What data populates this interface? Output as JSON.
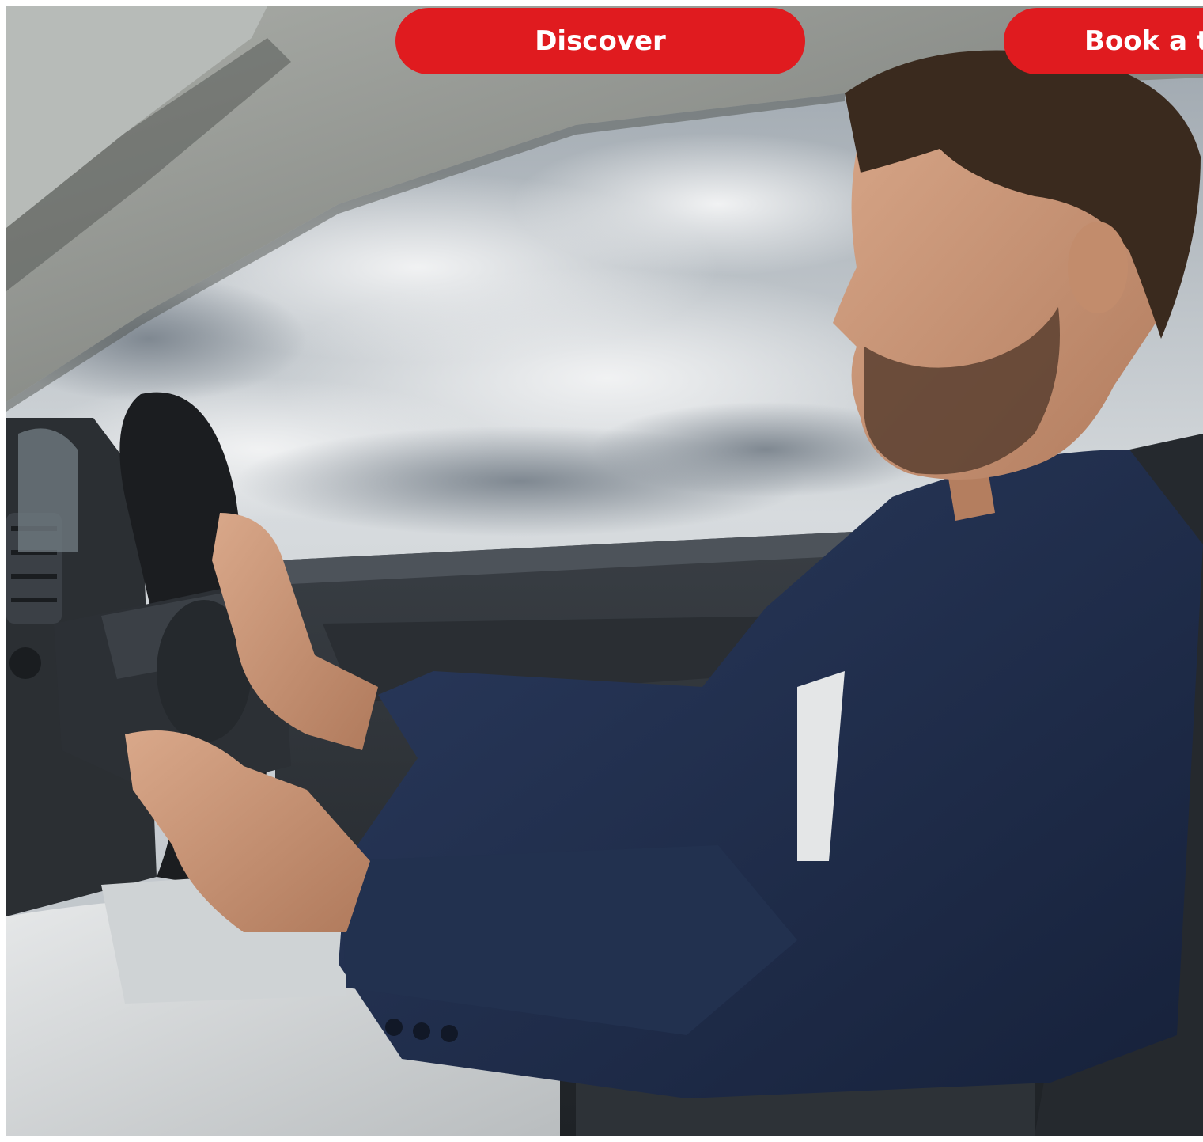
{
  "hero": {
    "image_description": "",
    "buttons": {
      "discover_label": "Discover",
      "book_label": "Book a t"
    }
  },
  "colors": {
    "cta_background": "#e01b1f",
    "cta_text": "#ffffff",
    "sky": "#c9ced3",
    "headliner": "#8f928e",
    "jacket": "#1f2d4a",
    "trousers": "#d6d9da",
    "dashboard": "#2b2f33"
  },
  "icons": {
    "steering_wheel": "steering-wheel-illustration",
    "person": "driver-illustration"
  }
}
